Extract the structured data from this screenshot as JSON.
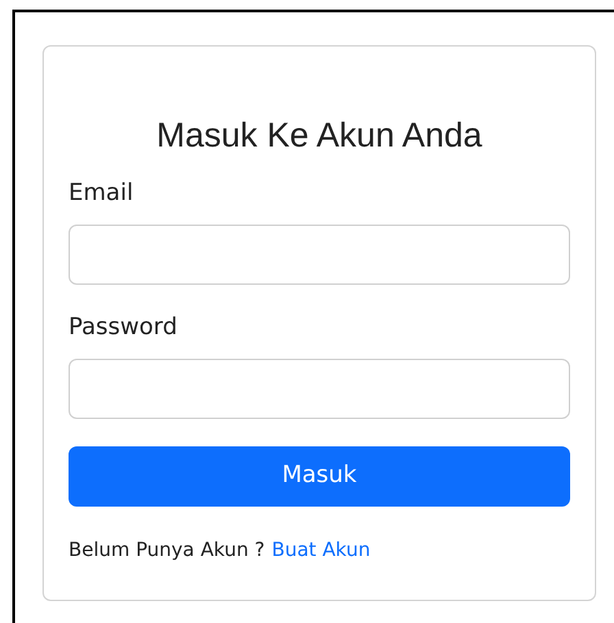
{
  "title": "Masuk Ke Akun Anda",
  "fields": [
    {
      "label": "Email"
    },
    {
      "label": "Password"
    }
  ],
  "button": "Masuk",
  "footer": {
    "text": "Belum Punya Akun ?",
    "link": "Buat Akun"
  }
}
